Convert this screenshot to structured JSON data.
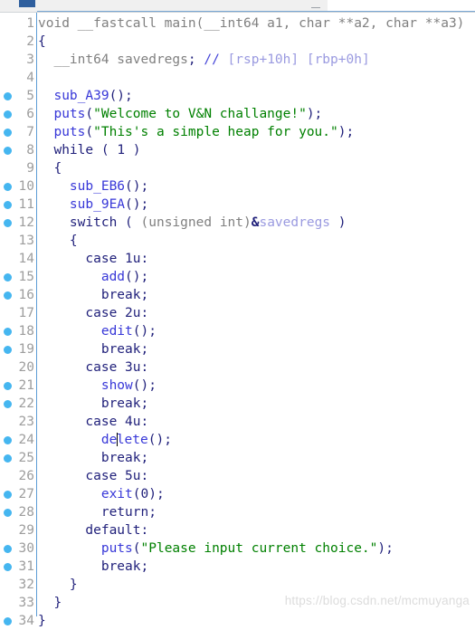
{
  "window": {
    "chrome_left_label": "",
    "minimize_label": "—"
  },
  "editor": {
    "language": "c-pseudocode",
    "watermark": "https://blog.csdn.net/mcmuyanga",
    "colors": {
      "background": "#ffffff",
      "line_number": "#9d9d9d",
      "gutter_rule": "#5b9bd5",
      "breakpoint_dot": "#45b6f0",
      "keyword": "#1f1f7a",
      "function": "#3838d8",
      "string": "#008000",
      "comment": "#4545d8",
      "comment_detail": "#9a9ae0",
      "variable": "#9a9ae0",
      "plain": "#808080",
      "watermark": "#dcdcdc"
    },
    "lines": [
      {
        "n": "1",
        "bp": false,
        "tokens": [
          {
            "c": "plain",
            "t": "void __fastcall main(__int64 a1, char **a2, char **a3)"
          }
        ]
      },
      {
        "n": "2",
        "bp": false,
        "tokens": [
          {
            "c": "punct",
            "t": "{"
          }
        ]
      },
      {
        "n": "3",
        "bp": false,
        "tokens": [
          {
            "c": "plain",
            "t": "  __int64 savedregs"
          },
          {
            "c": "punct",
            "t": ";"
          },
          {
            "c": "plain",
            "t": " "
          },
          {
            "c": "cmt",
            "t": "//"
          },
          {
            "c": "plain",
            "t": " "
          },
          {
            "c": "cmttxt",
            "t": "[rsp+10h] [rbp+0h]"
          }
        ]
      },
      {
        "n": "4",
        "bp": false,
        "tokens": [
          {
            "c": "plain",
            "t": ""
          }
        ]
      },
      {
        "n": "5",
        "bp": true,
        "tokens": [
          {
            "c": "plain",
            "t": "  "
          },
          {
            "c": "fn",
            "t": "sub_A39"
          },
          {
            "c": "punct",
            "t": "();"
          }
        ]
      },
      {
        "n": "6",
        "bp": true,
        "tokens": [
          {
            "c": "plain",
            "t": "  "
          },
          {
            "c": "fn",
            "t": "puts"
          },
          {
            "c": "punct",
            "t": "("
          },
          {
            "c": "str",
            "t": "\"Welcome to V&N challange!\""
          },
          {
            "c": "punct",
            "t": ");"
          }
        ]
      },
      {
        "n": "7",
        "bp": true,
        "tokens": [
          {
            "c": "plain",
            "t": "  "
          },
          {
            "c": "fn",
            "t": "puts"
          },
          {
            "c": "punct",
            "t": "("
          },
          {
            "c": "str",
            "t": "\"This's a simple heap for you.\""
          },
          {
            "c": "punct",
            "t": ");"
          }
        ]
      },
      {
        "n": "8",
        "bp": true,
        "tokens": [
          {
            "c": "plain",
            "t": "  "
          },
          {
            "c": "kw",
            "t": "while"
          },
          {
            "c": "punct",
            "t": " ( "
          },
          {
            "c": "num",
            "t": "1"
          },
          {
            "c": "punct",
            "t": " )"
          }
        ]
      },
      {
        "n": "9",
        "bp": false,
        "tokens": [
          {
            "c": "punct",
            "t": "  {"
          }
        ]
      },
      {
        "n": "10",
        "bp": true,
        "tokens": [
          {
            "c": "plain",
            "t": "    "
          },
          {
            "c": "fn",
            "t": "sub_EB6"
          },
          {
            "c": "punct",
            "t": "();"
          }
        ]
      },
      {
        "n": "11",
        "bp": true,
        "tokens": [
          {
            "c": "plain",
            "t": "    "
          },
          {
            "c": "fn",
            "t": "sub_9EA"
          },
          {
            "c": "punct",
            "t": "();"
          }
        ]
      },
      {
        "n": "12",
        "bp": true,
        "tokens": [
          {
            "c": "plain",
            "t": "    "
          },
          {
            "c": "kw",
            "t": "switch"
          },
          {
            "c": "punct",
            "t": " ( "
          },
          {
            "c": "plain",
            "t": "(unsigned int)"
          },
          {
            "c": "amp",
            "t": "&"
          },
          {
            "c": "var",
            "t": "savedregs"
          },
          {
            "c": "punct",
            "t": " )"
          }
        ]
      },
      {
        "n": "13",
        "bp": false,
        "tokens": [
          {
            "c": "punct",
            "t": "    {"
          }
        ]
      },
      {
        "n": "14",
        "bp": false,
        "tokens": [
          {
            "c": "plain",
            "t": "      "
          },
          {
            "c": "kw",
            "t": "case"
          },
          {
            "c": "plain",
            "t": " "
          },
          {
            "c": "num",
            "t": "1u"
          },
          {
            "c": "punct",
            "t": ":"
          }
        ]
      },
      {
        "n": "15",
        "bp": true,
        "tokens": [
          {
            "c": "plain",
            "t": "        "
          },
          {
            "c": "fn",
            "t": "add"
          },
          {
            "c": "punct",
            "t": "();"
          }
        ]
      },
      {
        "n": "16",
        "bp": true,
        "tokens": [
          {
            "c": "plain",
            "t": "        "
          },
          {
            "c": "kw",
            "t": "break"
          },
          {
            "c": "punct",
            "t": ";"
          }
        ]
      },
      {
        "n": "17",
        "bp": false,
        "tokens": [
          {
            "c": "plain",
            "t": "      "
          },
          {
            "c": "kw",
            "t": "case"
          },
          {
            "c": "plain",
            "t": " "
          },
          {
            "c": "num",
            "t": "2u"
          },
          {
            "c": "punct",
            "t": ":"
          }
        ]
      },
      {
        "n": "18",
        "bp": true,
        "tokens": [
          {
            "c": "plain",
            "t": "        "
          },
          {
            "c": "fn",
            "t": "edit"
          },
          {
            "c": "punct",
            "t": "();"
          }
        ]
      },
      {
        "n": "19",
        "bp": true,
        "tokens": [
          {
            "c": "plain",
            "t": "        "
          },
          {
            "c": "kw",
            "t": "break"
          },
          {
            "c": "punct",
            "t": ";"
          }
        ]
      },
      {
        "n": "20",
        "bp": false,
        "tokens": [
          {
            "c": "plain",
            "t": "      "
          },
          {
            "c": "kw",
            "t": "case"
          },
          {
            "c": "plain",
            "t": " "
          },
          {
            "c": "num",
            "t": "3u"
          },
          {
            "c": "punct",
            "t": ":"
          }
        ]
      },
      {
        "n": "21",
        "bp": true,
        "tokens": [
          {
            "c": "plain",
            "t": "        "
          },
          {
            "c": "fn",
            "t": "show"
          },
          {
            "c": "punct",
            "t": "();"
          }
        ]
      },
      {
        "n": "22",
        "bp": true,
        "tokens": [
          {
            "c": "plain",
            "t": "        "
          },
          {
            "c": "kw",
            "t": "break"
          },
          {
            "c": "punct",
            "t": ";"
          }
        ]
      },
      {
        "n": "23",
        "bp": false,
        "tokens": [
          {
            "c": "plain",
            "t": "      "
          },
          {
            "c": "kw",
            "t": "case"
          },
          {
            "c": "plain",
            "t": " "
          },
          {
            "c": "num",
            "t": "4u"
          },
          {
            "c": "punct",
            "t": ":"
          }
        ]
      },
      {
        "n": "24",
        "bp": true,
        "caret_after": 2,
        "tokens": [
          {
            "c": "plain",
            "t": "        "
          },
          {
            "c": "fn",
            "t": "de"
          },
          {
            "c": "caret",
            "t": ""
          },
          {
            "c": "fn",
            "t": "lete"
          },
          {
            "c": "punct",
            "t": "();"
          }
        ]
      },
      {
        "n": "25",
        "bp": true,
        "tokens": [
          {
            "c": "plain",
            "t": "        "
          },
          {
            "c": "kw",
            "t": "break"
          },
          {
            "c": "punct",
            "t": ";"
          }
        ]
      },
      {
        "n": "26",
        "bp": false,
        "tokens": [
          {
            "c": "plain",
            "t": "      "
          },
          {
            "c": "kw",
            "t": "case"
          },
          {
            "c": "plain",
            "t": " "
          },
          {
            "c": "num",
            "t": "5u"
          },
          {
            "c": "punct",
            "t": ":"
          }
        ]
      },
      {
        "n": "27",
        "bp": true,
        "tokens": [
          {
            "c": "plain",
            "t": "        "
          },
          {
            "c": "fn",
            "t": "exit"
          },
          {
            "c": "punct",
            "t": "("
          },
          {
            "c": "num",
            "t": "0"
          },
          {
            "c": "punct",
            "t": ");"
          }
        ]
      },
      {
        "n": "28",
        "bp": true,
        "tokens": [
          {
            "c": "plain",
            "t": "        "
          },
          {
            "c": "kw",
            "t": "return"
          },
          {
            "c": "punct",
            "t": ";"
          }
        ]
      },
      {
        "n": "29",
        "bp": false,
        "tokens": [
          {
            "c": "plain",
            "t": "      "
          },
          {
            "c": "kw",
            "t": "default"
          },
          {
            "c": "punct",
            "t": ":"
          }
        ]
      },
      {
        "n": "30",
        "bp": true,
        "tokens": [
          {
            "c": "plain",
            "t": "        "
          },
          {
            "c": "fn",
            "t": "puts"
          },
          {
            "c": "punct",
            "t": "("
          },
          {
            "c": "str",
            "t": "\"Please input current choice.\""
          },
          {
            "c": "punct",
            "t": ");"
          }
        ]
      },
      {
        "n": "31",
        "bp": true,
        "tokens": [
          {
            "c": "plain",
            "t": "        "
          },
          {
            "c": "kw",
            "t": "break"
          },
          {
            "c": "punct",
            "t": ";"
          }
        ]
      },
      {
        "n": "32",
        "bp": false,
        "tokens": [
          {
            "c": "punct",
            "t": "    }"
          }
        ]
      },
      {
        "n": "33",
        "bp": false,
        "tokens": [
          {
            "c": "punct",
            "t": "  }"
          }
        ]
      },
      {
        "n": "34",
        "bp": true,
        "tokens": [
          {
            "c": "punct",
            "t": "}"
          }
        ]
      }
    ]
  }
}
